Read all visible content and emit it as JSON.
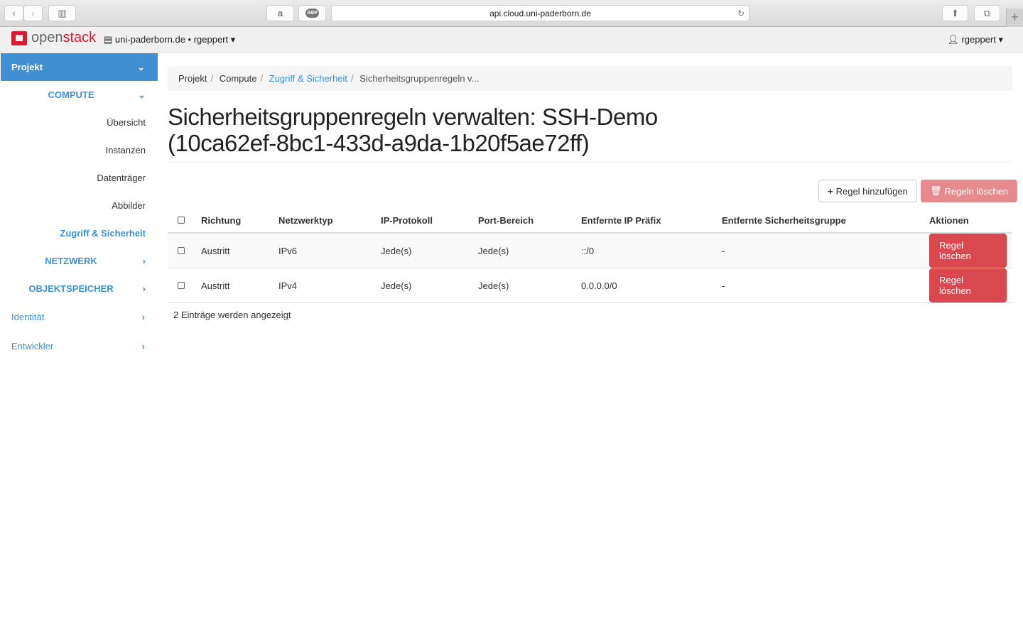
{
  "browser": {
    "url": "api.cloud.uni-paderborn.de",
    "amazon": "a",
    "abp": "ABP"
  },
  "topbar": {
    "logo_a": "open",
    "logo_b": "stack",
    "project": "uni-paderborn.de • rgeppert",
    "user": "rgeppert"
  },
  "sidebar": {
    "project": "Projekt",
    "compute": "COMPUTE",
    "items": [
      "Übersicht",
      "Instanzen",
      "Datenträger",
      "Abbilder",
      "Zugriff & Sicherheit"
    ],
    "netzwerk": "NETZWERK",
    "objekt": "OBJEKTSPEICHER",
    "identitaet": "Identität",
    "entwickler": "Entwickler"
  },
  "breadcrumb": [
    "Projekt",
    "Compute",
    "Zugriff & Sicherheit",
    "Sicherheitsgruppenregeln v..."
  ],
  "title_line1": "Sicherheitsgruppenregeln verwalten: SSH-Demo",
  "title_line2": "(10ca62ef-8bc1-433d-a9da-1b20f5ae72ff)",
  "actions": {
    "add": "Regel hinzufügen",
    "delete": "Regeln löschen"
  },
  "table": {
    "headers": [
      "Richtung",
      "Netzwerktyp",
      "IP-Protokoll",
      "Port-Bereich",
      "Entfernte IP Präfix",
      "Entfernte Sicherheitsgruppe",
      "Aktionen"
    ],
    "rows": [
      [
        "Austritt",
        "IPv6",
        "Jede(s)",
        "Jede(s)",
        "::/0",
        "-",
        "Regel löschen"
      ],
      [
        "Austritt",
        "IPv4",
        "Jede(s)",
        "Jede(s)",
        "0.0.0.0/0",
        "-",
        "Regel löschen"
      ]
    ]
  },
  "count": "2 Einträge werden angezeigt",
  "colors": {
    "accent": "#3f8fd2",
    "danger": "#d9474f",
    "brand": "#da1a32"
  }
}
